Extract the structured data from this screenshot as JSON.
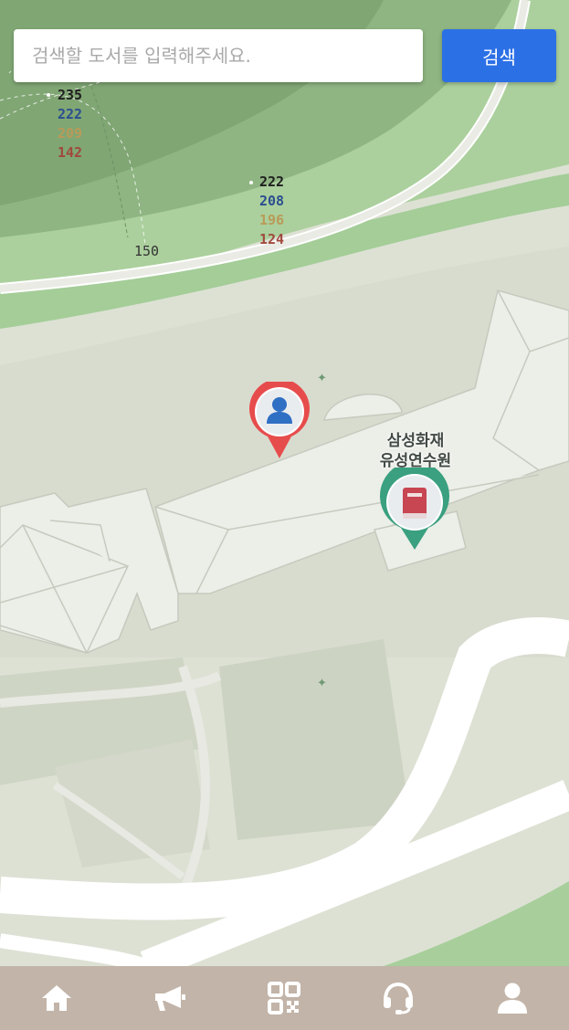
{
  "search": {
    "placeholder": "검색할 도서를 입력해주세요.",
    "button_label": "검색"
  },
  "map": {
    "contours_a": {
      "label_1": "235",
      "label_2": "222",
      "label_3": "209",
      "label_4": "142"
    },
    "contours_b": {
      "label_1": "222",
      "label_2": "208",
      "label_3": "196",
      "label_4": "124"
    },
    "contour_c": "150",
    "poi_label_line1": "삼성화재",
    "poi_label_line2": "유성연수원"
  },
  "markers": {
    "user": "user-location-marker",
    "library": "library-book-marker"
  },
  "nav": {
    "items": [
      "home-icon",
      "megaphone-icon",
      "qr-code-icon",
      "headset-icon",
      "profile-icon"
    ]
  },
  "colors": {
    "accent": "#2c70e6",
    "nav_bg": "#c2b4a8",
    "user_marker": "#e74c4c",
    "library_marker": "#3aa07f"
  }
}
